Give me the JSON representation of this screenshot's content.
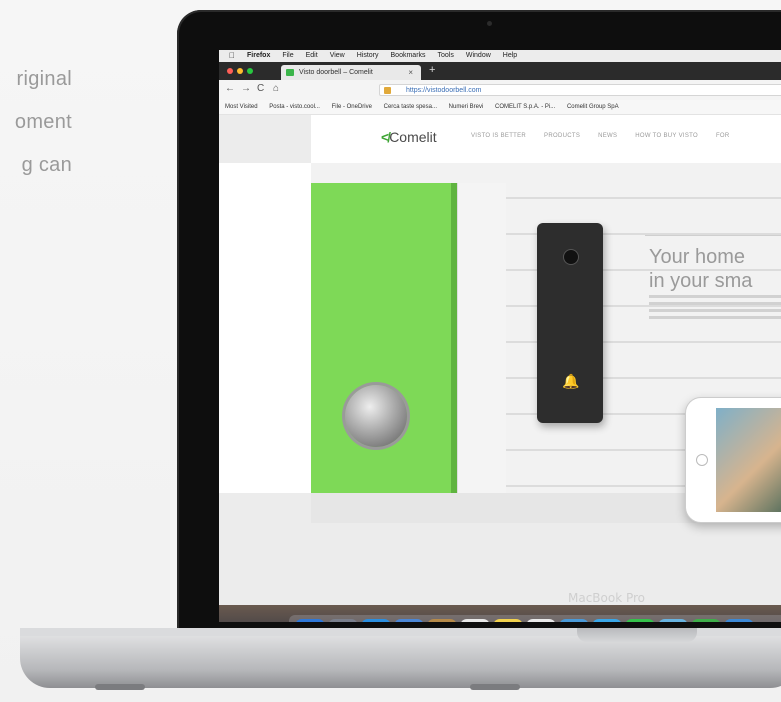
{
  "side_text": [
    "riginal",
    "oment",
    "g can"
  ],
  "laptop": {
    "brand": "MacBook Pro"
  },
  "menubar": {
    "apple": "",
    "app": "Firefox",
    "items": [
      "File",
      "Edit",
      "View",
      "History",
      "Bookmarks",
      "Tools",
      "Window",
      "Help"
    ]
  },
  "browser": {
    "tab_title": "Visto doorbell – Comelit",
    "tab_close": "×",
    "new_tab": "+",
    "nav": {
      "back": "←",
      "forward": "→",
      "reload": "C",
      "home": "⌂"
    },
    "url": "https://vistodoorbell.com",
    "bookmarks": [
      "Most Visited",
      "Posta - visto.cool...",
      "File - OneDrive",
      "Cerca taste spesa...",
      "Numeri Brevi",
      "COMELIT S.p.A. - Pi...",
      "Comelit Group SpA"
    ]
  },
  "website": {
    "logo": "Comelit",
    "logo_mark": "≮",
    "nav": [
      "VISTO IS BETTER",
      "PRODUCTS",
      "NEWS",
      "HOW TO BUY VISTO",
      "FOR"
    ],
    "headline_line1": "Your home",
    "headline_line2": "in your sma",
    "doorbell_bell": "🔔"
  },
  "dock": {
    "icons": [
      {
        "name": "finder-icon",
        "glyph": "☺",
        "color": "#2f78d8"
      },
      {
        "name": "launchpad-icon",
        "glyph": "✦",
        "color": "#7a7f8c"
      },
      {
        "name": "safari-icon",
        "glyph": "◎",
        "color": "#2b8fe0"
      },
      {
        "name": "mail-stamp-icon",
        "glyph": "✉",
        "color": "#4c87d6"
      },
      {
        "name": "notebook-icon",
        "glyph": "▤",
        "color": "#b68a4a"
      },
      {
        "name": "calendar-icon",
        "glyph": "18",
        "color": "#e9e9e9"
      },
      {
        "name": "notes-icon",
        "glyph": "≡",
        "color": "#f2d24e"
      },
      {
        "name": "reminders-icon",
        "glyph": "☰",
        "color": "#eaeaea"
      },
      {
        "name": "photos-icon",
        "glyph": "❁",
        "color": "#4a9ad8"
      },
      {
        "name": "messages-icon",
        "glyph": "…",
        "color": "#3aa7e8"
      },
      {
        "name": "facetime-icon",
        "glyph": "▶",
        "color": "#35c24b"
      },
      {
        "name": "maps-icon",
        "glyph": "⌖",
        "color": "#68b3e0"
      },
      {
        "name": "numbers-icon",
        "glyph": "▮",
        "color": "#3fae4a"
      },
      {
        "name": "keynote-icon",
        "glyph": "◆",
        "color": "#3d89d6"
      }
    ]
  },
  "colors": {
    "accent_green": "#7ed957",
    "brand_green": "#3fa535"
  }
}
